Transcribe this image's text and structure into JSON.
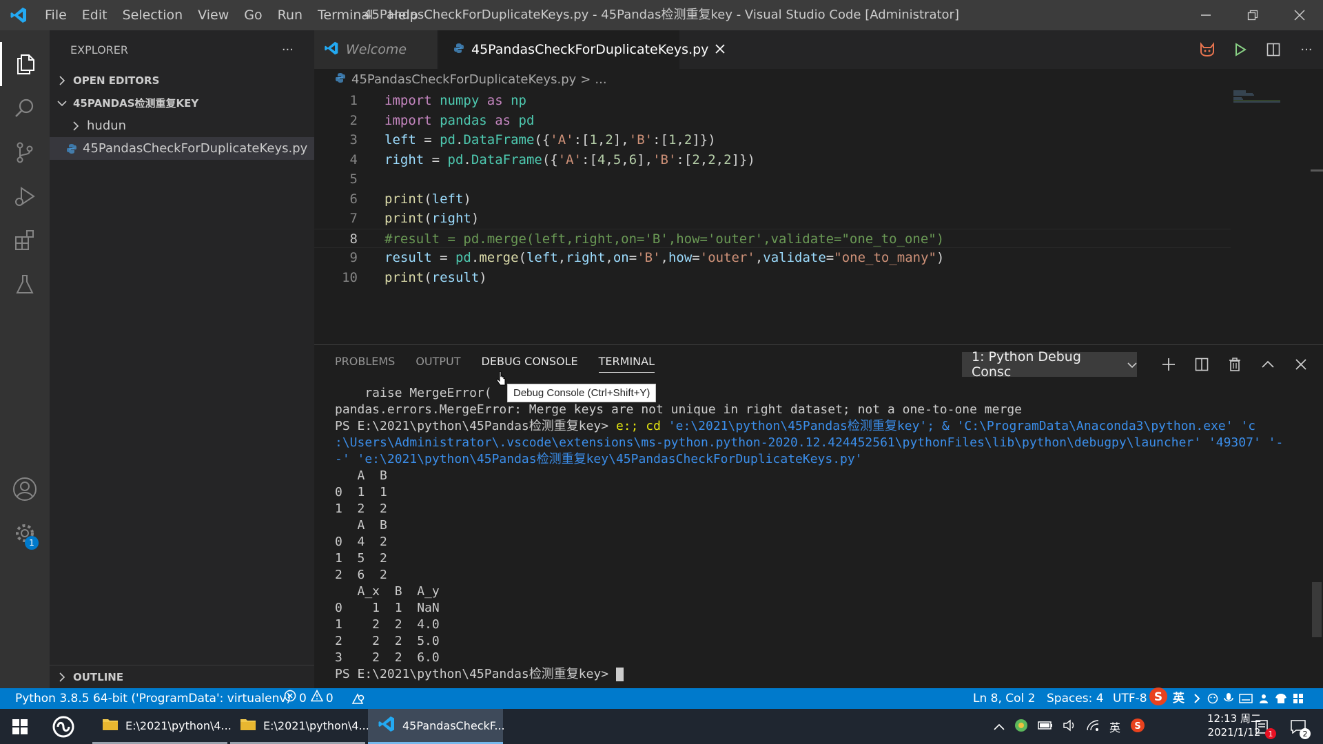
{
  "titlebar": {
    "menu": [
      "File",
      "Edit",
      "Selection",
      "View",
      "Go",
      "Run",
      "Terminal",
      "Help"
    ],
    "title": "45PandasCheckForDuplicateKeys.py - 45Pandas检测重复key - Visual Studio Code [Administrator]"
  },
  "activity_bar": {
    "items": [
      "explorer-icon",
      "search-icon",
      "source-control-icon",
      "run-debug-icon",
      "extensions-icon",
      "testing-icon"
    ],
    "settings_badge": "1"
  },
  "sidebar": {
    "title": "EXPLORER",
    "more": "···",
    "open_editors": "OPEN EDITORS",
    "folder": "45PANDAS检测重复KEY",
    "subfolder": "hudun",
    "file": "45PandasCheckForDuplicateKeys.py",
    "outline": "OUTLINE"
  },
  "tabs": [
    {
      "label": "Welcome",
      "active": false
    },
    {
      "label": "45PandasCheckForDuplicateKeys.py",
      "active": true
    }
  ],
  "breadcrumb": {
    "file": "45PandasCheckForDuplicateKeys.py",
    "sep": ">",
    "rest": "..."
  },
  "code_lines": [
    "1",
    "2",
    "3",
    "4",
    "5",
    "6",
    "7",
    "8",
    "9",
    "10"
  ],
  "panel": {
    "tabs": [
      "PROBLEMS",
      "OUTPUT",
      "DEBUG CONSOLE",
      "TERMINAL"
    ],
    "active_tab": "TERMINAL",
    "terminal_select": "1: Python Debug Consc",
    "tooltip": "Debug Console (Ctrl+Shift+Y)"
  },
  "terminal": {
    "line_raise": "    raise MergeError(",
    "line_error": "pandas.errors.MergeError: Merge keys are not unique in right dataset; not a one-to-one merge",
    "prompt": "PS E:\\2021\\python\\45Pandas检测重复key>",
    "cmd_yellow": " e:; cd",
    "cmd1_rest": " 'e:\\2021\\python\\45Pandas检测重复key'; & 'C:\\ProgramData\\Anaconda3\\python.exe' 'c",
    "cmd2": ":\\Users\\Administrator\\.vscode\\extensions\\ms-python.python-2020.12.424452561\\pythonFiles\\lib\\python\\debugpy\\launcher' '49307' '-",
    "cmd3": "-' 'e:\\2021\\python\\45Pandas检测重复key\\45PandasCheckForDuplicateKeys.py'",
    "output": [
      "   A  B",
      "0  1  1",
      "1  2  2",
      "   A  B",
      "0  4  2",
      "1  5  2",
      "2  6  2",
      "   A_x  B  A_y",
      "0    1  1  NaN",
      "1    2  2  4.0",
      "2    2  2  5.0",
      "3    2  2  6.0"
    ],
    "final_prompt": "PS E:\\2021\\python\\45Pandas检测重复key> "
  },
  "statusbar": {
    "python": "Python 3.8.5 64-bit ('ProgramData': virtualenv)",
    "errors": "0",
    "warnings": "0",
    "position": "Ln 8, Col 2",
    "spaces": "Spaces: 4",
    "encoding": "UTF-8",
    "ime": "英"
  },
  "taskbar": {
    "apps": [
      {
        "label": "E:\\2021\\python\\4...",
        "state": "open"
      },
      {
        "label": "E:\\2021\\python\\4...",
        "state": "open"
      },
      {
        "label": "45PandasCheckF...",
        "state": "active"
      }
    ],
    "ime": "英",
    "time": "12:13 周二",
    "date": "2021/1/12",
    "notif_badge": "1",
    "action_badge": "2"
  },
  "colors": {
    "accent": "#007acc",
    "keyword": "#c586c0",
    "string": "#ce9178",
    "comment": "#6a9955"
  }
}
